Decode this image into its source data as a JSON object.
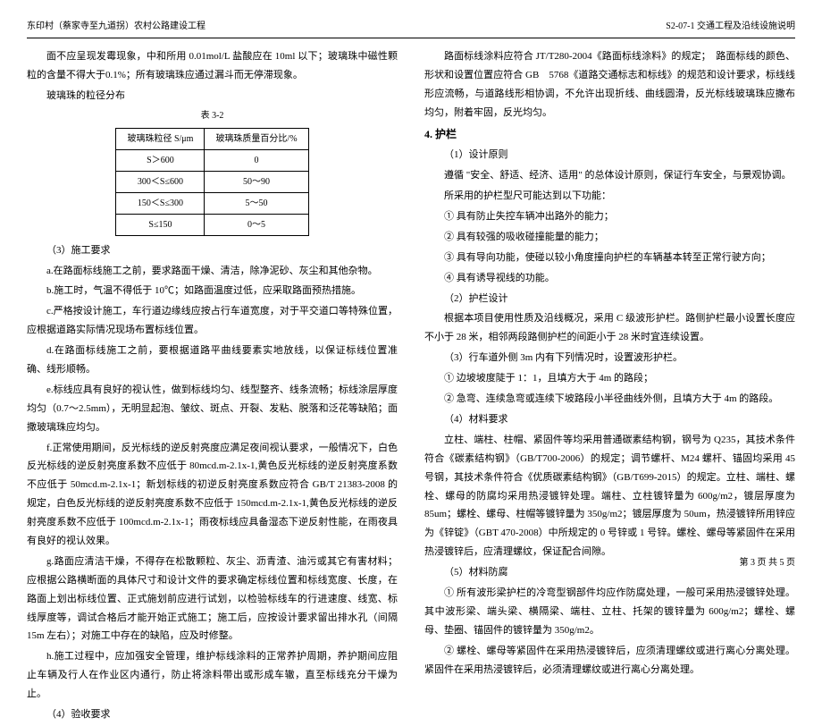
{
  "header": {
    "left": "东印村（蔡家寺至九道拐）农村公路建设工程",
    "right": "S2-07-1 交通工程及沿线设施说明"
  },
  "left_col": {
    "p1": "面不应呈现发霉现象，中和所用 0.01mol/L 盐酸应在 10ml 以下；玻璃珠中磁性颗粒的含量不得大于0.1%；所有玻璃珠应通过漏斗而无停滞现象。",
    "bead_title": "玻璃珠的粒径分布",
    "table_caption": "表 3-2",
    "table": {
      "h1": "玻璃珠粒径 S/μm",
      "h2": "玻璃珠质量百分比/%",
      "rows": [
        [
          "S＞600",
          "0"
        ],
        [
          "300＜S≤600",
          "50～90"
        ],
        [
          "150＜S≤300",
          "5～50"
        ],
        [
          "S≤150",
          "0～5"
        ]
      ]
    },
    "s3_title": "（3）施工要求",
    "s3_a": "a.在路面标线施工之前，要求路面干燥、清洁，除净泥砂、灰尘和其他杂物。",
    "s3_b": "b.施工时，气温不得低于 10℃；如路面温度过低，应采取路面预热措施。",
    "s3_c": "c.严格按设计施工，车行道边缘线应按占行车道宽度，对于平交道口等特殊位置，应根据道路实际情况现场布置标线位置。",
    "s3_d": "d.在路面标线施工之前，要根据道路平曲线要素实地放线，以保证标线位置准确、线形顺畅。",
    "s3_e": "e.标线应具有良好的视认性，做到标线均匀、线型整齐、线条流畅；标线涂层厚度均匀（0.7～2.5mm），无明显起泡、皱纹、斑点、开裂、发粘、脱落和泛花等缺陷；面撒玻璃珠应均匀。",
    "s3_f": "f.正常使用期间，反光标线的逆反射亮度应满足夜间视认要求，一般情况下，白色反光标线的逆反射亮度系数不应低于 80mcd.m-2.1x-1,黄色反光标线的逆反射亮度系数不应低于 50mcd.m-2.1x-1；新划标线的初逆反射亮度系数应符合 GB/T 21383-2008 的规定，白色反光标线的逆反射亮度系数不应低于 150mcd.m-2.1x-1,黄色反光标线的逆反射亮度系数不应低于 100mcd.m-2.1x-1；雨夜标线应具备湿态下逆反射性能，在雨夜具有良好的视认效果。",
    "s3_g": "g.路面应清洁干燥，不得存在松散颗粒、灰尘、沥青渣、油污或其它有害材料；应根据公路横断面的具体尺寸和设计文件的要求确定标线位置和标线宽度、长度，在路面上划出标线位置、正式施划前应进行试划，以检验标线车的行进速度、线宽、标线厚度等，调试合格后才能开始正式施工；施工后，应按设计要求留出排水孔（间隔 15m 左右）；对施工中存在的缺陷，应及时修整。",
    "s3_h": "h.施工过程中，应加强安全管理，维护标线涂料的正常养护周期，养护期间应阻止车辆及行人在作业区内通行，防止将涂料带出或形成车辙，直至标线充分干燥为止。",
    "s4_title": "（4）验收要求"
  },
  "right_col": {
    "p1": "路面标线涂料应符合 JT/T280-2004《路面标线涂料》的规定；　路面标线的颜色、形状和设置位置应符合 GB　5768《道路交通标志和标线》的规范和设计要求，标线线形应流畅，与道路线形相协调，不允许出现折线、曲线圆滑，反光标线玻璃珠应撒布均匀，附着牢固，反光均匀。",
    "h4": "4. 护栏",
    "d1_title": "（1）设计原则",
    "d1_p1": "遵循 \"安全、舒适、经济、适用\" 的总体设计原则，保证行车安全，与景观协调。",
    "d1_p2": "所采用的护栏型尺可能达到以下功能：",
    "d1_li1": "① 具有防止失控车辆冲出路外的能力；",
    "d1_li2": "② 具有较强的吸收碰撞能量的能力；",
    "d1_li3": "③ 具有导向功能，使碰以较小角度撞向护栏的车辆基本转至正常行驶方向；",
    "d1_li4": "④ 具有诱导视线的功能。",
    "d2_title": "（2）护栏设计",
    "d2_p1": "根据本项目使用性质及沿线概况，采用 C 级波形护栏。路侧护栏最小设置长度应不小于 28 米，相邻两段路侧护栏的间距小于 28 米时宜连续设置。",
    "d3_title": "（3）行车道外侧 3m 内有下列情况时，设置波形护栏。",
    "d3_li1": "① 边坡坡度陡于 1：1，且填方大于 4m 的路段；",
    "d3_li2": "② 急弯、连续急弯或连续下坡路段小半径曲线外侧，且填方大于 4m 的路段。",
    "d4_title": "（4）材料要求",
    "d4_p1": "立柱、端柱、柱帽、紧固件等均采用普通碳素结构钢，钢号为 Q235，其技术条件符合《碳素结构钢》（GB/T700-2006）的规定；调节螺杆、M24 螺杆、锚固均采用 45 号钢，其技术条件符合《优质碳素结构钢》（GB/T699-2015）的规定。立柱、端柱、螺栓、螺母的防腐均采用热浸镀锌处理。端柱、立柱镀锌量为 600g/m2，镀层厚度为 85um；螺栓、螺母、柱帽等镀锌量为 350g/m2；镀层厚度为 50um，热浸镀锌所用锌应为《锌锭》（GBT 470-2008）中所规定的 0 号锌或 1 号锌。螺栓、螺母等紧固件在采用热浸镀锌后，应清理螺纹，保证配合间隙。",
    "d5_title": "（5）材料防腐",
    "d5_li1": "① 所有波形梁护栏的冷弯型钢部件均应作防腐处理，一般可采用热浸镀锌处理。其中波形梁、端头梁、横隔梁、端柱、立柱、托架的镀锌量为 600g/m2；螺栓、螺母、垫圈、锚固件的镀锌量为 350g/m2。",
    "d5_li2": "② 螺栓、螺母等紧固件在采用热浸镀锌后，应须清理螺纹或进行离心分离处理。紧固件在采用热浸镀锌后，必须清理螺纹或进行离心分离处理。"
  },
  "footer": "第 3 页 共 5 页"
}
